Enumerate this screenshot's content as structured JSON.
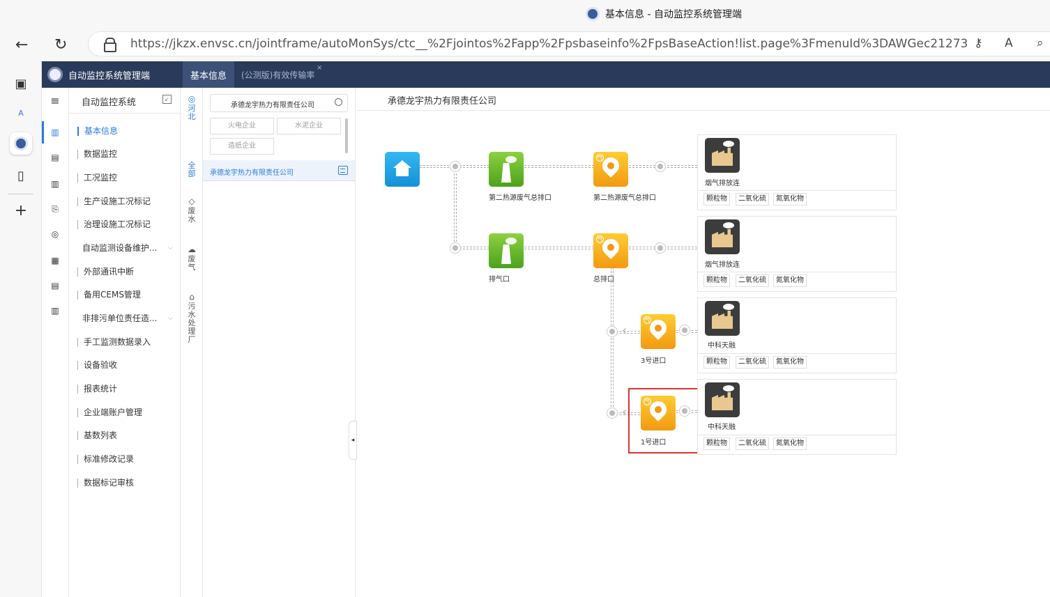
{
  "browser": {
    "window_title": "基本信息 - 自动监控系统管理端",
    "url": "https://jkzx.envsc.cn/jointframe/autoMonSys/ctc__%2Fjointos%2Fapp%2Fpsbaseinfo%2FpsBaseAction!list.page%3FmenuId%3DAWGec21273bde9e40173..."
  },
  "app": {
    "brand": "自动监控系统管理端",
    "tabs": [
      {
        "label": "基本信息",
        "active": true
      },
      {
        "label": "(公测版)有效传输率",
        "active": false
      }
    ]
  },
  "menu": {
    "header": "自动监控系统",
    "items": [
      {
        "label": "基本信息",
        "active": true
      },
      {
        "label": "数据监控"
      },
      {
        "label": "工况监控"
      },
      {
        "label": "生产设施工况标记"
      },
      {
        "label": "治理设施工况标记"
      },
      {
        "label": "自动监测设备维护...",
        "expandable": true
      },
      {
        "label": "外部通讯中断"
      },
      {
        "label": "备用CEMS管理"
      },
      {
        "label": "非排污单位责任造...",
        "expandable": true
      },
      {
        "label": "手工监测数据录入"
      },
      {
        "label": "设备验收"
      },
      {
        "label": "报表统计"
      },
      {
        "label": "企业端账户管理"
      },
      {
        "label": "基数列表"
      },
      {
        "label": "标准修改记录"
      },
      {
        "label": "数据标记审核"
      }
    ]
  },
  "regions": {
    "province": "河北",
    "filters": [
      {
        "label": "全部",
        "active": true
      },
      {
        "label": "废水"
      },
      {
        "label": "废气"
      },
      {
        "label": "污水处理厂"
      }
    ]
  },
  "enterprise_panel": {
    "search_value": "承德龙宇热力有限责任公司",
    "categories": [
      "火电企业",
      "水泥企业",
      "造纸企业"
    ],
    "selected": "承德龙宇热力有限责任公司"
  },
  "main": {
    "title": "承德龙宇热力有限责任公司",
    "gas_badge": "气",
    "nodes": {
      "n1": "第二热源废气总排口",
      "n2": "第二热源废气总排口",
      "n3": "排气口",
      "n4": "总排口",
      "n5": "3号进口",
      "n6": "1号进口"
    },
    "cards": [
      {
        "name": "烟气排放连",
        "pollutants": [
          "颗粒物",
          "二氧化硫",
          "氮氧化物"
        ]
      },
      {
        "name": "烟气排放连",
        "pollutants": [
          "颗粒物",
          "二氧化硫",
          "氮氧化物"
        ]
      },
      {
        "name": "中科天融",
        "pollutants": [
          "颗粒物",
          "二氧化硫",
          "氮氧化物"
        ]
      },
      {
        "name": "中科天融",
        "pollutants": [
          "颗粒物",
          "二氧化硫",
          "氮氧化物"
        ]
      }
    ]
  }
}
